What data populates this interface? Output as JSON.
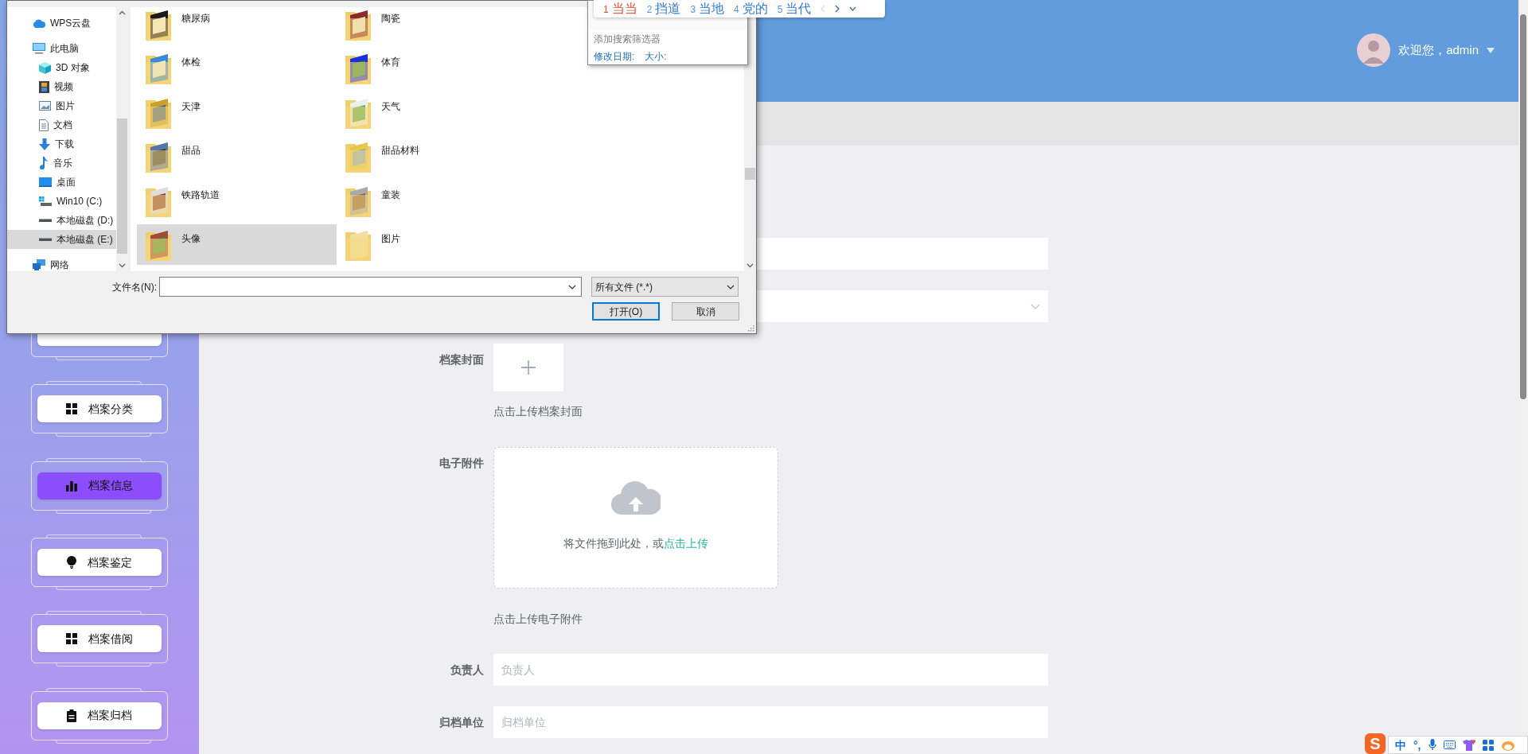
{
  "file_dialog": {
    "nav": [
      {
        "label": "WPS云盘",
        "kind": "cloud",
        "selected": false
      },
      {
        "label": "此电脑",
        "kind": "computer",
        "selected": false,
        "children": [
          {
            "label": "3D 对象",
            "kind": "cube",
            "selected": false
          },
          {
            "label": "视频",
            "kind": "film",
            "selected": false
          },
          {
            "label": "图片",
            "kind": "image",
            "selected": false
          },
          {
            "label": "文档",
            "kind": "document",
            "selected": false
          },
          {
            "label": "下载",
            "kind": "download",
            "selected": false
          },
          {
            "label": "音乐",
            "kind": "music",
            "selected": false
          },
          {
            "label": "桌面",
            "kind": "desktop",
            "selected": false
          },
          {
            "label": "Win10 (C:)",
            "kind": "system",
            "selected": false
          },
          {
            "label": "本地磁盘 (D:)",
            "kind": "drive",
            "selected": false
          },
          {
            "label": "本地磁盘 (E:)",
            "kind": "drive",
            "selected": true
          }
        ]
      },
      {
        "label": "网络",
        "kind": "network",
        "selected": false
      }
    ],
    "files": [
      {
        "label": "糖尿病",
        "selected": false
      },
      {
        "label": "陶瓷",
        "selected": false
      },
      {
        "label": "体检",
        "selected": false
      },
      {
        "label": "体育",
        "selected": false
      },
      {
        "label": "天津",
        "selected": false
      },
      {
        "label": "天气",
        "selected": false
      },
      {
        "label": "甜品",
        "selected": false
      },
      {
        "label": "甜品材料",
        "selected": false
      },
      {
        "label": "铁路轨道",
        "selected": false
      },
      {
        "label": "童装",
        "selected": false
      },
      {
        "label": "头像",
        "selected": true
      },
      {
        "label": "图片",
        "selected": false
      }
    ],
    "filename_label": "文件名(N):",
    "file_type": "所有文件 (*.*)",
    "buttons": [
      {
        "label": "打开(O)",
        "default": true
      },
      {
        "label": "取消",
        "default": false
      }
    ]
  },
  "search_popup": {
    "filter_hint": "添加搜索筛选器",
    "filters": [
      "修改日期:",
      "大小:"
    ]
  },
  "ime_candidates": [
    {
      "index": "1",
      "text": "当当",
      "selected": true
    },
    {
      "index": "2",
      "text": "挡道",
      "selected": false
    },
    {
      "index": "3",
      "text": "当地",
      "selected": false
    },
    {
      "index": "4",
      "text": "党的",
      "selected": false
    },
    {
      "index": "5",
      "text": "当代",
      "selected": false
    }
  ],
  "header": {
    "greeting": "欢迎您，admin"
  },
  "sidebar": {
    "items": [
      {
        "selected": false
      },
      {
        "label": "档案分类",
        "kind": "grid",
        "selected": false
      },
      {
        "label": "档案信息",
        "kind": "bars",
        "selected": true
      },
      {
        "label": "档案鉴定",
        "kind": "bulb",
        "selected": false
      },
      {
        "label": "档案借阅",
        "kind": "grid",
        "selected": false
      },
      {
        "label": "档案归档",
        "kind": "clipboard",
        "selected": false
      }
    ]
  },
  "form": {
    "rows": [
      {
        "kind": "input"
      },
      {
        "kind": "select"
      },
      {
        "kind": "image_upload",
        "label": "档案封面",
        "hint": "点击上传档案封面"
      },
      {
        "kind": "file_upload",
        "label": "电子附件",
        "drop_text": "将文件拖到此处，或",
        "drop_link": "点击上传",
        "hint": "点击上传电子附件"
      },
      {
        "kind": "input",
        "label": "负责人",
        "placeholder": "负责人"
      },
      {
        "kind": "input",
        "label": "归档单位",
        "placeholder": "归档单位"
      }
    ]
  },
  "ime_toolbar": {
    "logo": "S",
    "items": [
      "中",
      "°,"
    ]
  }
}
